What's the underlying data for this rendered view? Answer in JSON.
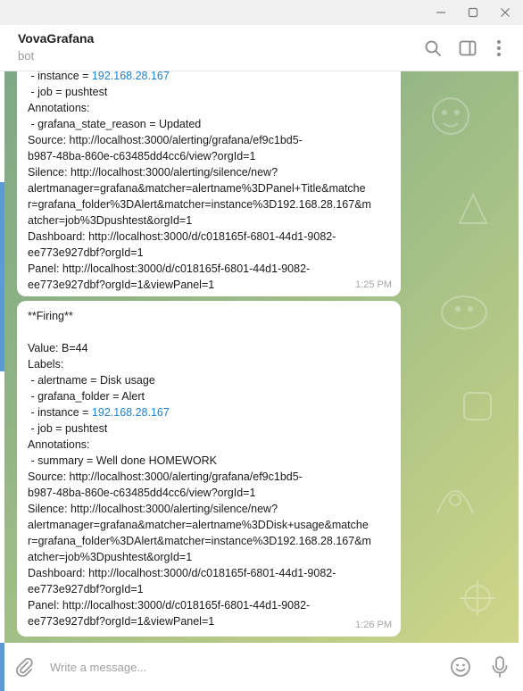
{
  "window": {
    "minimize_icon": "minimize-icon",
    "maximize_icon": "maximize-icon",
    "close_icon": "close-icon"
  },
  "header": {
    "title": "VovaGrafana",
    "subtitle": "bot",
    "icons": [
      "search-icon",
      "sidebar-toggle-icon",
      "more-vertical-icon"
    ]
  },
  "messages": [
    {
      "lines": [
        {
          "pre": " - instance = ",
          "ip": "192.168.28.167"
        },
        {
          "text": " - job = pushtest"
        },
        {
          "text": "Annotations:"
        },
        {
          "text": " - grafana_state_reason = Updated"
        },
        {
          "text": "Source: http://localhost:3000/alerting/grafana/ef9c1bd5-"
        },
        {
          "text": "b987-48ba-860e-c63485dd4cc6/view?orgId=1"
        },
        {
          "text": "Silence: http://localhost:3000/alerting/silence/new?"
        },
        {
          "text": "alertmanager=grafana&matcher=alertname%3DPanel+Title&matche"
        },
        {
          "text": "r=grafana_folder%3DAlert&matcher=instance%3D192.168.28.167&m"
        },
        {
          "text": "atcher=job%3Dpushtest&orgId=1"
        },
        {
          "text": "Dashboard: http://localhost:3000/d/c018165f-6801-44d1-9082-"
        },
        {
          "text": "ee773e927dbf?orgId=1"
        },
        {
          "text": "Panel: http://localhost:3000/d/c018165f-6801-44d1-9082-"
        },
        {
          "text": "ee773e927dbf?orgId=1&viewPanel=1"
        }
      ],
      "time": "1:25 PM"
    },
    {
      "lines": [
        {
          "text": "**Firing**"
        },
        {
          "text": ""
        },
        {
          "text": "Value: B=44"
        },
        {
          "text": "Labels:"
        },
        {
          "text": " - alertname = Disk usage"
        },
        {
          "text": " - grafana_folder = Alert"
        },
        {
          "pre": " - instance = ",
          "ip": "192.168.28.167"
        },
        {
          "text": " - job = pushtest"
        },
        {
          "text": "Annotations:"
        },
        {
          "text": " - summary = Well done HOMEWORK"
        },
        {
          "text": "Source: http://localhost:3000/alerting/grafana/ef9c1bd5-"
        },
        {
          "text": "b987-48ba-860e-c63485dd4cc6/view?orgId=1"
        },
        {
          "text": "Silence: http://localhost:3000/alerting/silence/new?"
        },
        {
          "text": "alertmanager=grafana&matcher=alertname%3DDisk+usage&matche"
        },
        {
          "text": "r=grafana_folder%3DAlert&matcher=instance%3D192.168.28.167&m"
        },
        {
          "text": "atcher=job%3Dpushtest&orgId=1"
        },
        {
          "text": "Dashboard: http://localhost:3000/d/c018165f-6801-44d1-9082-"
        },
        {
          "text": "ee773e927dbf?orgId=1"
        },
        {
          "text": "Panel: http://localhost:3000/d/c018165f-6801-44d1-9082-"
        },
        {
          "text": "ee773e927dbf?orgId=1&viewPanel=1"
        }
      ],
      "time": "1:26 PM"
    }
  ],
  "composer": {
    "placeholder": "Write a message...",
    "icons": [
      "paperclip-icon",
      "emoji-icon",
      "microphone-icon"
    ]
  },
  "colors": {
    "link": "#2481cc",
    "accent": "#5a9bd4",
    "wallpaper_start": "#7fa886",
    "wallpaper_end": "#cfd68a"
  }
}
